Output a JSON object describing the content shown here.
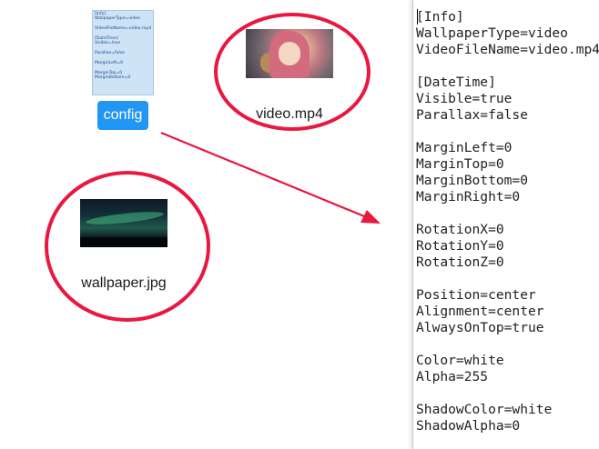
{
  "desktop": {
    "config_file": {
      "preview_lines": [
        "[Info]",
        "WallpaperType=video",
        "",
        "VideoFileName=video.mp4",
        "",
        "[DateTime]",
        "Visible=true",
        "",
        "Parallax=false",
        "",
        "MarginLeft=0",
        "",
        "MarginTop=0",
        "MarginBottom=0"
      ],
      "label": "config"
    },
    "video_file": {
      "label": "video.mp4",
      "icon": "video-thumbnail-icon"
    },
    "wallpaper_file": {
      "label": "wallpaper.jpg",
      "icon": "image-thumbnail-icon"
    },
    "annotation_color": "#e8183f"
  },
  "editor": {
    "lines": [
      "[Info]",
      "WallpaperType=video",
      "VideoFileName=video.mp4",
      "",
      "[DateTime]",
      "Visible=true",
      "Parallax=false",
      "",
      "MarginLeft=0",
      "MarginTop=0",
      "MarginBottom=0",
      "MarginRight=0",
      "",
      "RotationX=0",
      "RotationY=0",
      "RotationZ=0",
      "",
      "Position=center",
      "Alignment=center",
      "AlwaysOnTop=true",
      "",
      "Color=white",
      "Alpha=255",
      "",
      "ShadowColor=white",
      "ShadowAlpha=0"
    ]
  }
}
